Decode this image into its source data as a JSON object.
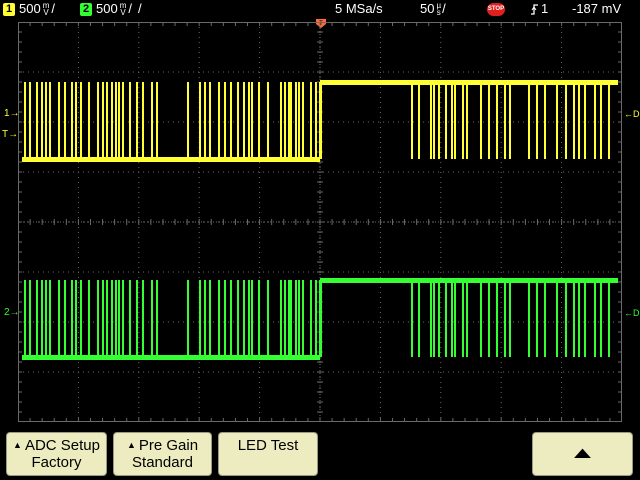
{
  "status": {
    "ch1_number": "1",
    "ch1_scale": "500",
    "ch1_unit_top": "m",
    "ch1_unit_bottom": "V",
    "ch2_number": "2",
    "ch2_scale": "500",
    "ch2_unit_top": "m",
    "ch2_unit_bottom": "V",
    "sample_rate": "5 MSa/s",
    "timebase": "50",
    "time_unit_top": "µ",
    "time_unit_bottom": "s",
    "run_state": "STOP",
    "trigger_source": "1",
    "trigger_level": "-187 mV"
  },
  "markers": {
    "ch1": "1",
    "ch2": "2",
    "trigger": "T",
    "dc1": "DC",
    "dc2": "DC"
  },
  "softkeys": {
    "adc_setup_title": "ADC Setup",
    "adc_setup_value": "Factory",
    "pre_gain_title": "Pre Gain",
    "pre_gain_value": "Standard",
    "led_test_title": "LED Test",
    "up_arrow": "▲"
  },
  "colors": {
    "ch1": "#ffff33",
    "ch2": "#33ff33",
    "grid": "#6a6a6a",
    "softkey_bg": "#ececc0",
    "trigger": "#ff6a3d"
  }
}
